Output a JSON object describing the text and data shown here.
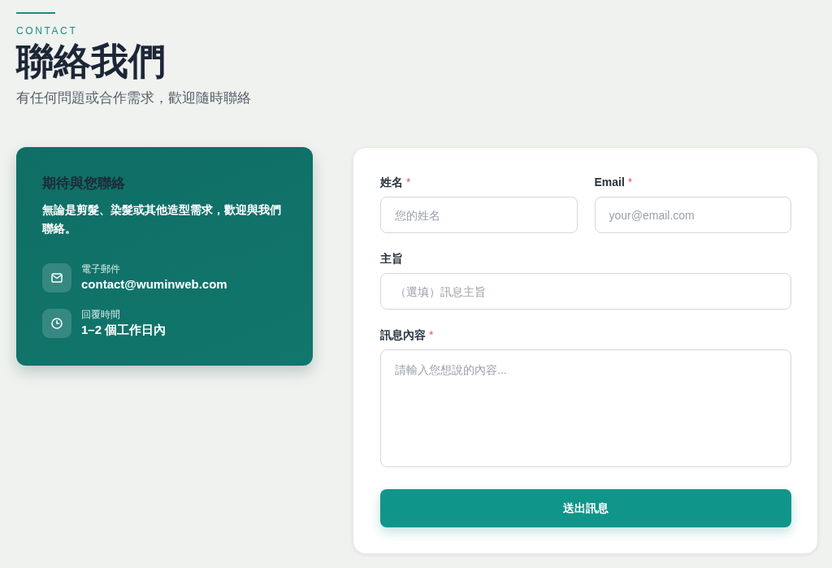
{
  "header": {
    "eyebrow": "CONTACT",
    "title": "聯絡我們",
    "subtitle": "有任何問題或合作需求，歡迎隨時聯絡"
  },
  "info_card": {
    "heading": "期待與您聯絡",
    "text": "無論是剪髮、染髮或其他造型需求，歡迎與我們聯絡。",
    "items": [
      {
        "kind": "email",
        "label": "電子郵件",
        "value": "contact@wuminweb.com"
      },
      {
        "kind": "clock",
        "label": "回覆時間",
        "value": "1–2 個工作日內"
      }
    ]
  },
  "form": {
    "rows": [
      [
        {
          "kind": "input",
          "label": "姓名",
          "required_mark": "*",
          "placeholder": "您的姓名"
        },
        {
          "kind": "input",
          "label": "Email",
          "required_mark": "*",
          "placeholder": "your@email.com"
        }
      ],
      [
        {
          "kind": "input",
          "label": "主旨",
          "placeholder": "（選填）訊息主旨"
        }
      ],
      [
        {
          "kind": "textarea",
          "label": "訊息內容",
          "required_mark": "*",
          "placeholder": "請輸入您想說的內容..."
        }
      ]
    ],
    "submit": "送出訊息"
  }
}
